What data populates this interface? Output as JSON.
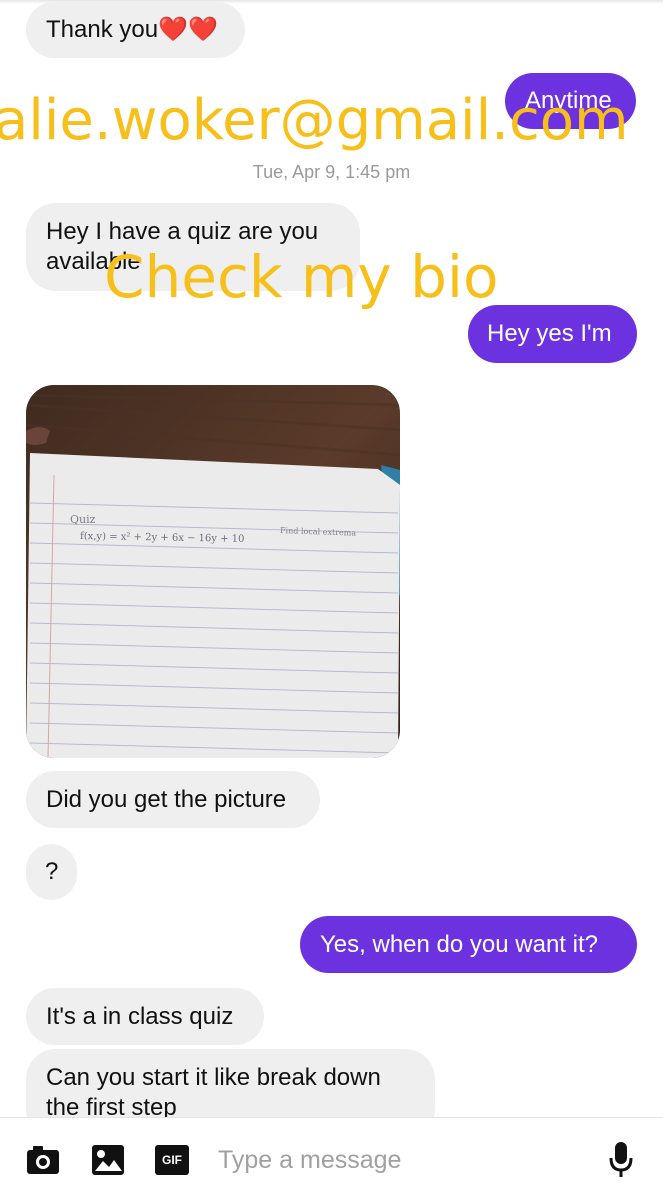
{
  "messages": [
    {
      "side": "in",
      "text": "Thank you❤️❤️"
    },
    {
      "side": "out",
      "text": "Anytime"
    },
    {
      "side": "in",
      "text_line1": "Hey I have a quiz are you",
      "text_line2": "available"
    },
    {
      "side": "out",
      "text": "Hey yes I'm"
    },
    {
      "side": "in",
      "text": "Did you get the picture"
    },
    {
      "side": "in",
      "text": "?"
    },
    {
      "side": "out",
      "text": "Yes,  when do you want it?"
    },
    {
      "side": "in",
      "text": "It's a in class quiz"
    },
    {
      "side": "in",
      "text_line1": "Can you start it like break down",
      "text_line2": "the first step"
    }
  ],
  "timestamp": "Tue, Apr 9, 1:45 pm",
  "overlay": {
    "email": "talie.woker@gmail.com",
    "bio": "Check my bio"
  },
  "photo": {
    "heading": "Quiz",
    "equation": "f(x,y) = x² + 2y + 6x − 16y + 10",
    "note": "Find local extrema"
  },
  "composer": {
    "placeholder": "Type a message",
    "gif_label": "GIF",
    "icons": [
      "camera-icon",
      "image-icon",
      "gif-icon",
      "microphone-icon"
    ]
  },
  "colors": {
    "outgoing": "#6d32df",
    "incoming": "#efefef",
    "overlay_text": "#f7bf1a"
  }
}
